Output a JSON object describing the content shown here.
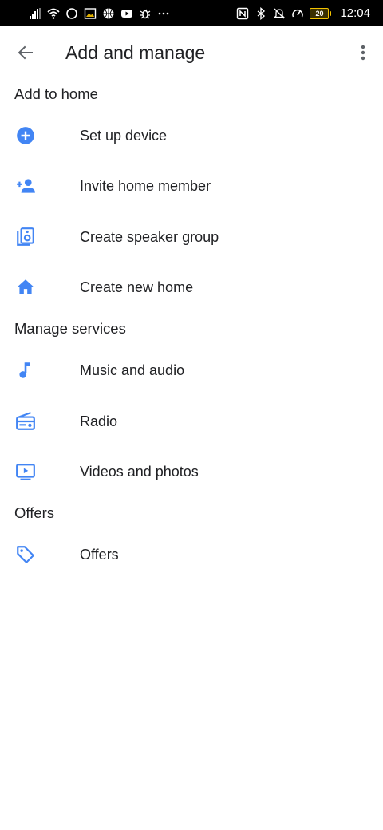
{
  "status_bar": {
    "time": "12:04",
    "battery_level": "20",
    "icons": [
      "signal-icon",
      "wifi-icon",
      "circle-icon",
      "photo-icon",
      "basketball-icon",
      "youtube-icon",
      "bug-icon",
      "more-notifications-icon",
      "nfc-icon",
      "bluetooth-icon",
      "mute-icon",
      "speed-icon",
      "battery-icon"
    ]
  },
  "app_bar": {
    "title": "Add and manage",
    "back_icon": "arrow-back-icon",
    "menu_icon": "more-vert-icon"
  },
  "colors": {
    "accent": "#4285f4",
    "text": "#202124",
    "status_bar_bg": "#000000"
  },
  "sections": {
    "add_to_home": {
      "title": "Add to home",
      "items": [
        {
          "label": "Set up device",
          "icon": "add-circle-icon"
        },
        {
          "label": "Invite home member",
          "icon": "person-add-icon"
        },
        {
          "label": "Create speaker group",
          "icon": "speaker-icon"
        },
        {
          "label": "Create new home",
          "icon": "home-icon"
        }
      ]
    },
    "manage_services": {
      "title": "Manage services",
      "items": [
        {
          "label": "Music and audio",
          "icon": "music-note-icon"
        },
        {
          "label": "Radio",
          "icon": "radio-icon"
        },
        {
          "label": "Videos and photos",
          "icon": "video-icon"
        }
      ]
    },
    "offers": {
      "title": "Offers",
      "items": [
        {
          "label": "Offers",
          "icon": "tag-icon"
        }
      ]
    }
  }
}
